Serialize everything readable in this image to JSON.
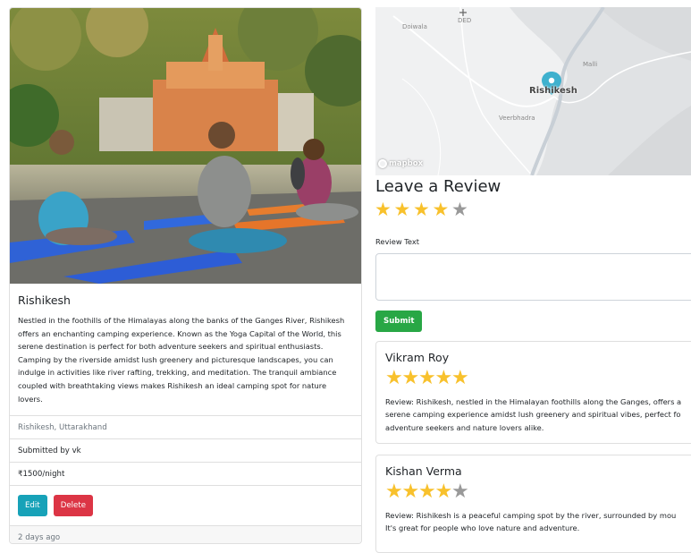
{
  "campground": {
    "title": "Rishikesh",
    "description": "Nestled in the foothills of the Himalayas along the banks of the Ganges River, Rishikesh offers an enchanting camping experience. Known as the Yoga Capital of the World, this serene destination is perfect for both adventure seekers and spiritual enthusiasts. Camping by the riverside amidst lush greenery and picturesque landscapes, you can indulge in activities like river rafting, trekking, and meditation. The tranquil ambiance coupled with breathtaking views makes Rishikesh an ideal camping spot for nature lovers.",
    "location": "Rishikesh, Uttarakhand",
    "submitted_by": "Submitted by vk",
    "price": "₹1500/night",
    "edit_label": "Edit",
    "delete_label": "Delete",
    "posted": "2 days ago"
  },
  "map": {
    "labels": {
      "ded": "DED",
      "doiwala": "Doiwala",
      "rishikesh": "Rishikesh",
      "veerbhadra": "Veerbhadra",
      "malli": "Malli"
    },
    "attribution": "mapbox"
  },
  "review_form": {
    "heading": "Leave a Review",
    "rating": 4,
    "text_label": "Review Text",
    "submit_label": "Submit"
  },
  "reviews": [
    {
      "author": "Vikram Roy",
      "rating": 5,
      "text_lines": [
        "Review: Rishikesh, nestled in the Himalayan foothills along the Ganges, offers a",
        "serene camping experience amidst lush greenery and spiritual vibes, perfect fo",
        "adventure seekers and nature lovers alike."
      ]
    },
    {
      "author": "Kishan Verma",
      "rating": 4,
      "text_lines": [
        "Review: Rishikesh is a peaceful camping spot by the river, surrounded by mou",
        "It's great for people who love nature and adventure."
      ]
    }
  ],
  "colors": {
    "star_on": "#f8c12c",
    "star_off": "#999999",
    "edit_button": "#17a2b8",
    "delete_button": "#dc3545",
    "submit_button": "#28a745",
    "map_marker": "#3fb1ce"
  }
}
